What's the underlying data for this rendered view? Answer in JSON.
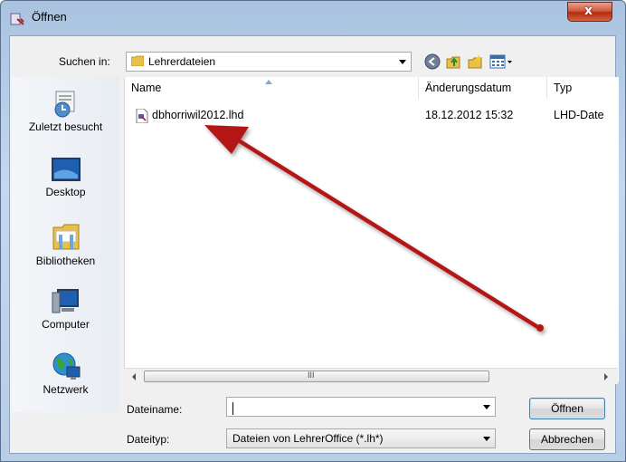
{
  "window": {
    "title": "Öffnen",
    "close_label": "x"
  },
  "lookin": {
    "label": "Suchen in:",
    "value": "Lehrerdateien"
  },
  "toolbar": {
    "icons": [
      "back-icon",
      "up-folder-icon",
      "new-folder-icon",
      "view-menu-icon"
    ]
  },
  "places": [
    {
      "label": "Zuletzt besucht",
      "icon": "recent-places-icon"
    },
    {
      "label": "Desktop",
      "icon": "desktop-icon"
    },
    {
      "label": "Bibliotheken",
      "icon": "libraries-icon"
    },
    {
      "label": "Computer",
      "icon": "computer-icon"
    },
    {
      "label": "Netzwerk",
      "icon": "network-icon"
    }
  ],
  "filelist": {
    "columns": [
      "Name",
      "Änderungsdatum",
      "Typ"
    ],
    "rows": [
      {
        "name": "dbhorriwil2012.lhd",
        "date": "18.12.2012 15:32",
        "type": "LHD-Date"
      }
    ],
    "scroll_grip": "III"
  },
  "filename": {
    "label": "Dateiname:",
    "value": ""
  },
  "filetype": {
    "label": "Dateityp:",
    "value": "Dateien von LehrerOffice (*.lh*)"
  },
  "buttons": {
    "open": "Öffnen",
    "cancel": "Abbrechen"
  },
  "colors": {
    "annotation_arrow": "#b41414",
    "title_close": "#c7422a",
    "selection_blue": "#3c7fb1"
  }
}
